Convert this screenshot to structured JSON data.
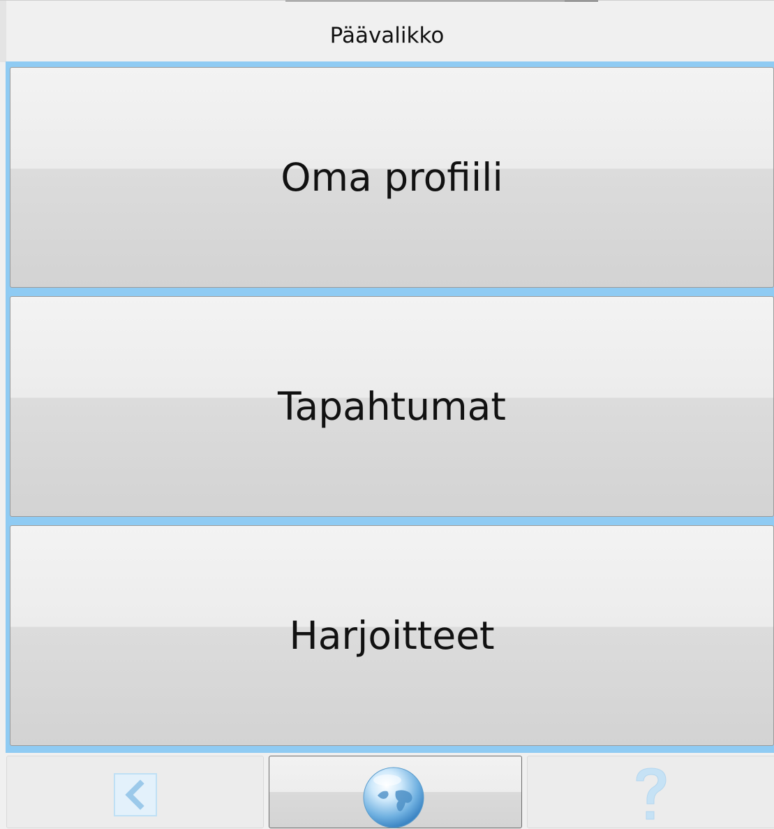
{
  "header": {
    "title": "Päävalikko"
  },
  "menu": {
    "items": [
      {
        "label": "Oma profiili"
      },
      {
        "label": "Tapahtumat"
      },
      {
        "label": "Harjoitteet"
      }
    ]
  },
  "colors": {
    "accent": "#8fcbf3",
    "background": "#f0f0f0",
    "button_top": "#f3f3f3",
    "button_bottom": "#d3d3d3"
  },
  "footer": {
    "icons": [
      "back-arrow-icon",
      "globe-icon",
      "help-icon"
    ],
    "back_icon_state": "disabled",
    "help_icon_state": "disabled",
    "globe_state": "active"
  }
}
